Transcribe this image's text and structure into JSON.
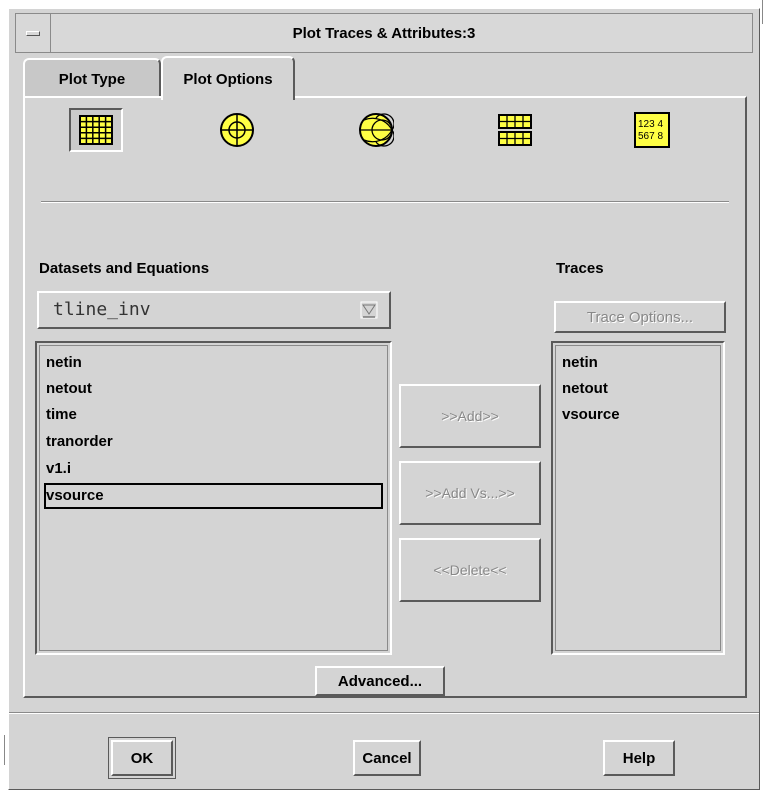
{
  "window": {
    "title": "Plot Traces & Attributes:3"
  },
  "tabs": [
    {
      "label": "Plot Type",
      "active": false
    },
    {
      "label": "Plot Options",
      "active": true
    }
  ],
  "plot_types": [
    {
      "name": "rectangular-plot-icon",
      "selected": true
    },
    {
      "name": "polar-plot-icon",
      "selected": false
    },
    {
      "name": "smith-chart-icon",
      "selected": false
    },
    {
      "name": "stacked-rectangular-plot-icon",
      "selected": false
    },
    {
      "name": "list-table-icon",
      "selected": false,
      "text_line1": "123 4",
      "text_line2": "567 8"
    }
  ],
  "datasets": {
    "label": "Datasets and Equations",
    "selected_dataset": "tline_inv",
    "items": [
      "netin",
      "netout",
      "time",
      "tranorder",
      "v1.i",
      "vsource"
    ],
    "selected_item": "vsource"
  },
  "actions": {
    "add": ">>Add>>",
    "add_vs": ">>Add Vs...>>",
    "delete": "<<Delete<<"
  },
  "traces": {
    "label": "Traces",
    "options_button": "Trace Options...",
    "items": [
      "netin",
      "netout",
      "vsource"
    ]
  },
  "advanced_button": "Advanced...",
  "footer": {
    "ok": "OK",
    "cancel": "Cancel",
    "help": "Help"
  },
  "colors": {
    "icon_fill": "#ffff44",
    "background": "#d4d4d4"
  }
}
